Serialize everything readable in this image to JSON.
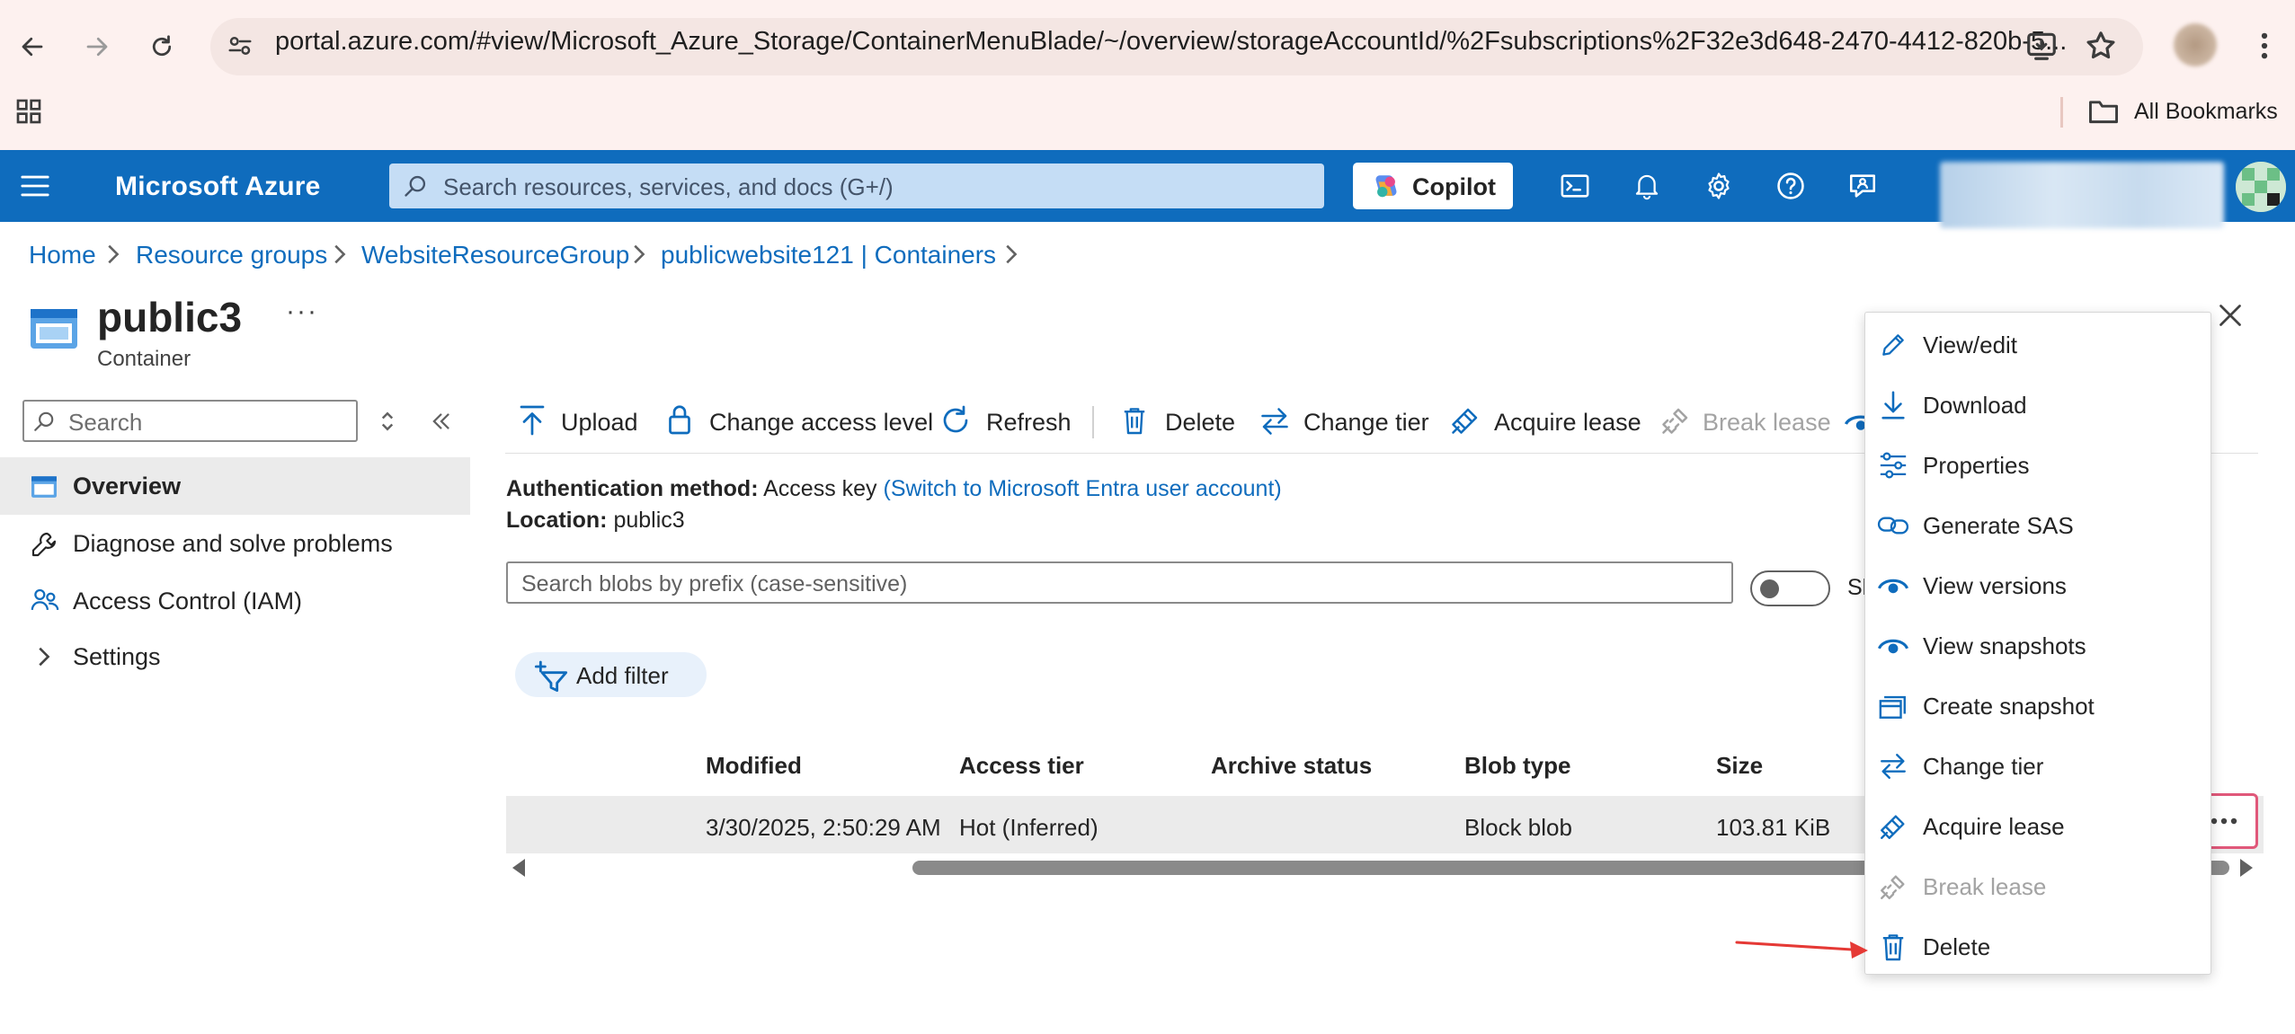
{
  "browser": {
    "url": "portal.azure.com/#view/Microsoft_Azure_Storage/ContainerMenuBlade/~/overview/storageAccountId/%2Fsubscriptions%2F32e3d648-2470-4412-820b-5...",
    "bookmarks_label": "All Bookmarks"
  },
  "topbar": {
    "brand": "Microsoft Azure",
    "search_placeholder": "Search resources, services, and docs (G+/)",
    "copilot_label": "Copilot",
    "accent_color": "#0f6cbd"
  },
  "breadcrumb": {
    "items": [
      "Home",
      "Resource groups",
      "WebsiteResourceGroup",
      "publicwebsite121 | Containers"
    ]
  },
  "header": {
    "title": "public3",
    "subtitle": "Container",
    "more": "···"
  },
  "sidebar": {
    "search_placeholder": "Search",
    "items": [
      {
        "label": "Overview",
        "icon": "container-icon",
        "selected": true
      },
      {
        "label": "Diagnose and solve problems",
        "icon": "wrench-icon"
      },
      {
        "label": "Access Control (IAM)",
        "icon": "people-icon"
      },
      {
        "label": "Settings",
        "icon": "chevron-right-icon"
      }
    ]
  },
  "toolbar": {
    "upload": "Upload",
    "change_access_level": "Change access level",
    "refresh": "Refresh",
    "delete": "Delete",
    "change_tier": "Change tier",
    "acquire_lease": "Acquire lease",
    "break_lease": "Break lease"
  },
  "info": {
    "auth_label": "Authentication method:",
    "auth_value": "Access key",
    "auth_switch": "(Switch to Microsoft Entra user account)",
    "location_label": "Location:",
    "location_value": "public3"
  },
  "blob_search": {
    "placeholder": "Search blobs by prefix (case-sensitive)",
    "toggle_label": "Sl"
  },
  "filter": {
    "add_filter": "Add filter"
  },
  "table": {
    "columns": [
      "Modified",
      "Access tier",
      "Archive status",
      "Blob type",
      "Size"
    ],
    "rows": [
      {
        "modified": "3/30/2025, 2:50:29 AM",
        "access_tier": "Hot (Inferred)",
        "archive_status": "",
        "blob_type": "Block blob",
        "size": "103.81 KiB"
      }
    ]
  },
  "context_menu": {
    "items": [
      {
        "label": "View/edit",
        "icon": "pencil-icon",
        "enabled": true
      },
      {
        "label": "Download",
        "icon": "download-icon",
        "enabled": true
      },
      {
        "label": "Properties",
        "icon": "sliders-icon",
        "enabled": true
      },
      {
        "label": "Generate SAS",
        "icon": "link-icon",
        "enabled": true
      },
      {
        "label": "View versions",
        "icon": "eye-icon",
        "enabled": true
      },
      {
        "label": "View snapshots",
        "icon": "eye-icon",
        "enabled": true
      },
      {
        "label": "Create snapshot",
        "icon": "snapshot-icon",
        "enabled": true
      },
      {
        "label": "Change tier",
        "icon": "swap-icon",
        "enabled": true
      },
      {
        "label": "Acquire lease",
        "icon": "lease-icon",
        "enabled": true
      },
      {
        "label": "Break lease",
        "icon": "break-lease-icon",
        "enabled": false
      },
      {
        "label": "Delete",
        "icon": "trash-icon",
        "enabled": true
      }
    ]
  },
  "annotation": {
    "highlight_color": "#e0587a",
    "arrow_color": "#e53935"
  }
}
